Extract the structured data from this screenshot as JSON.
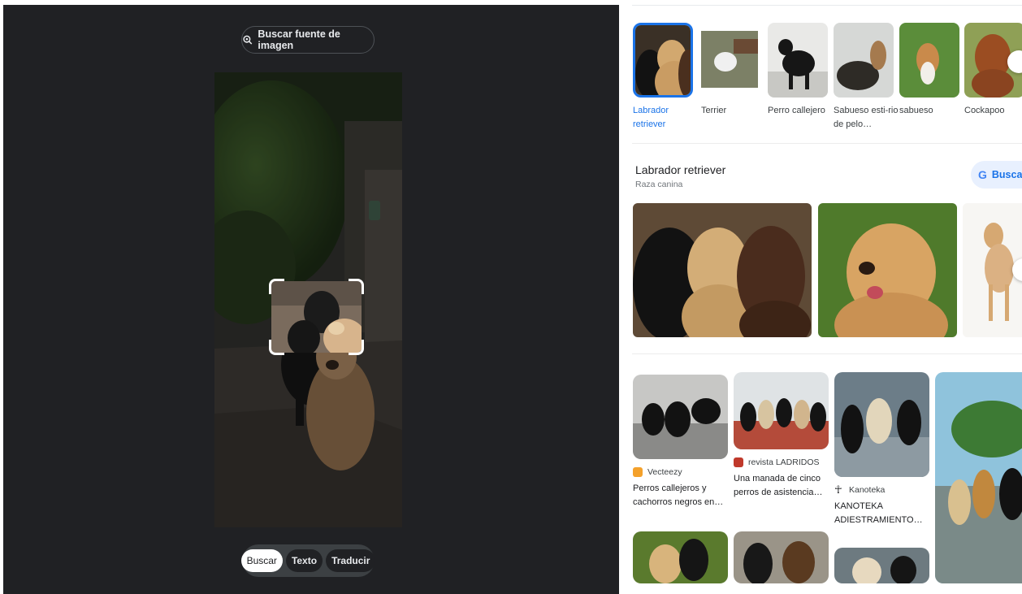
{
  "lens": {
    "source_button_label": "Buscar fuente de imagen",
    "modes": [
      "Buscar",
      "Texto",
      "Traducir"
    ],
    "active_mode": "Buscar"
  },
  "chips": [
    {
      "label": "Labrador retriever",
      "selected": true
    },
    {
      "label": "Terrier",
      "selected": false
    },
    {
      "label": "Perro callejero",
      "selected": false
    },
    {
      "label": "Sabueso esti-rio de pelo…",
      "selected": false
    },
    {
      "label": "sabueso",
      "selected": false
    },
    {
      "label": "Cockapoo",
      "selected": false
    }
  ],
  "entity": {
    "title": "Labrador retriever",
    "subtitle": "Raza canina",
    "search_label": "Buscar"
  },
  "results": [
    {
      "source": "Vecteezy",
      "title": "Perros callejeros y cachorros negros en…",
      "favicon_color": "#f4a12b"
    },
    {
      "source": "revista LADRIDOS",
      "title": "Una manada de cinco perros de asistencia…",
      "favicon_color": "#c0392b"
    },
    {
      "source": "Kanoteka",
      "title": "KANOTEKA ADIESTRAMIENTO…",
      "favicon_color": "#202124"
    }
  ],
  "colors": {
    "accent": "#1a73e8",
    "panel_dark": "#202124"
  }
}
